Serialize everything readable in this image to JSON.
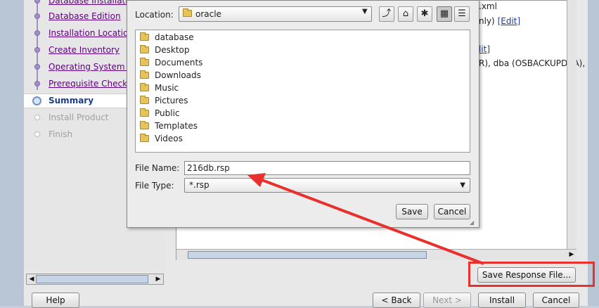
{
  "installer": {
    "steps": [
      {
        "label": "Database Installation Options",
        "state": "link"
      },
      {
        "label": "Database Edition",
        "state": "link"
      },
      {
        "label": "Installation Location",
        "state": "link"
      },
      {
        "label": "Create Inventory",
        "state": "link"
      },
      {
        "label": "Operating System Groups",
        "state": "link"
      },
      {
        "label": "Prerequisite Checks",
        "state": "link"
      },
      {
        "label": "Summary",
        "state": "current"
      },
      {
        "label": "Install Product",
        "state": "disabled"
      },
      {
        "label": "Finish",
        "state": "disabled"
      }
    ],
    "summary_fragments": {
      "line1": ".xml",
      "line2_prefix": "nly)",
      "edit_label": "[Edit]",
      "line3_edit": "lit]",
      "line4": "R), dba (OSBACKUPDBA),"
    },
    "buttons": {
      "save_response": "Save Response File...",
      "help": "Help",
      "back": "< Back",
      "next": "Next >",
      "install": "Install",
      "cancel": "Cancel"
    }
  },
  "dialog": {
    "location_label": "Location:",
    "location_value": "oracle",
    "folders": [
      "database",
      "Desktop",
      "Documents",
      "Downloads",
      "Music",
      "Pictures",
      "Public",
      "Templates",
      "Videos"
    ],
    "filename_label": "File Name:",
    "filename_value": "216db.rsp",
    "filetype_label": "File Type:",
    "filetype_value": "*.rsp",
    "save_label": "Save",
    "cancel_label": "Cancel"
  },
  "colors": {
    "annotation_red": "#e8302c",
    "link_purple": "#5b007a",
    "current_blue": "#1a3d8a"
  }
}
